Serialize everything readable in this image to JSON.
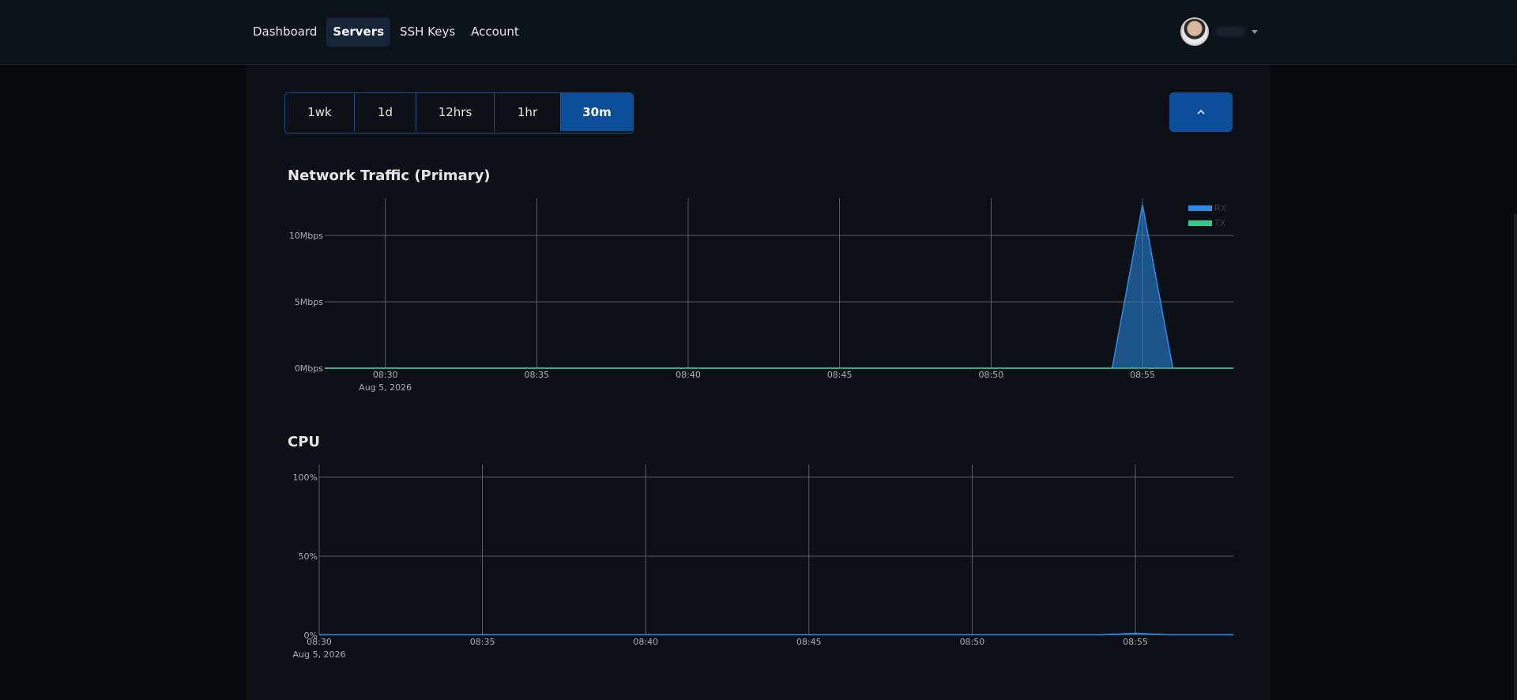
{
  "nav": {
    "items": [
      {
        "label": "Dashboard",
        "active": false
      },
      {
        "label": "Servers",
        "active": true
      },
      {
        "label": "SSH Keys",
        "active": false
      },
      {
        "label": "Account",
        "active": false
      }
    ]
  },
  "time_ranges": [
    {
      "label": "1wk",
      "active": false
    },
    {
      "label": "1d",
      "active": false
    },
    {
      "label": "12hrs",
      "active": false
    },
    {
      "label": "1hr",
      "active": false
    },
    {
      "label": "30m",
      "active": true
    }
  ],
  "colors": {
    "accent": "#0b4f9b",
    "rx": "#2b8ae6",
    "tx": "#2ecc8f",
    "grid": "#6c727a"
  },
  "chart_data": [
    {
      "type": "area",
      "title": "Network Traffic (Primary)",
      "x": [
        "08:30",
        "08:35",
        "08:40",
        "08:45",
        "08:50",
        "08:55"
      ],
      "x_date_label": "Aug 5, 2026",
      "yticks": [
        "0Mbps",
        "5Mbps",
        "10Mbps"
      ],
      "ytick_values": [
        0,
        5,
        10
      ],
      "ylim": [
        0,
        12.8
      ],
      "xlim": [
        "08:28",
        "08:58"
      ],
      "legend": {
        "placement": "top-right",
        "entries": [
          "RX",
          "TX"
        ]
      },
      "series": [
        {
          "name": "RX",
          "points": [
            [
              "08:28",
              0
            ],
            [
              "08:54",
              0
            ],
            [
              "08:55",
              12.3
            ],
            [
              "08:56",
              0
            ],
            [
              "08:58",
              0
            ]
          ]
        },
        {
          "name": "TX",
          "points": [
            [
              "08:28",
              0
            ],
            [
              "08:58",
              0
            ]
          ]
        }
      ],
      "grid": true
    },
    {
      "type": "area",
      "title": "CPU",
      "x": [
        "08:30",
        "08:35",
        "08:40",
        "08:45",
        "08:50",
        "08:55"
      ],
      "x_date_label": "Aug 5, 2026",
      "yticks": [
        "0%",
        "50%",
        "100%"
      ],
      "ytick_values": [
        0,
        50,
        100
      ],
      "ylim": [
        0,
        108
      ],
      "xlim": [
        "08:30",
        "08:58"
      ],
      "series": [
        {
          "name": "CPU",
          "points": [
            [
              "08:30",
              0.3
            ],
            [
              "08:54",
              0.3
            ],
            [
              "08:55",
              1.2
            ],
            [
              "08:56",
              0.3
            ],
            [
              "08:58",
              0.3
            ]
          ]
        }
      ],
      "grid": true
    }
  ]
}
